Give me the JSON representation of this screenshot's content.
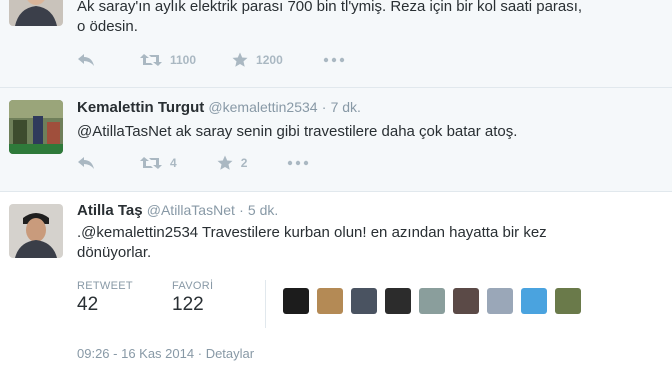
{
  "tweets": [
    {
      "text_line1": "Ak saray'ın aylık elektrik parası 700 bin tl'ymiş. Reza için bir kol saati parası,",
      "text_line2": "o ödesin.",
      "retweets": "1100",
      "favorites": "1200"
    },
    {
      "name": "Kemalettin Turgut",
      "handle": "@kemalettin2534",
      "sep": "·",
      "time": "7 dk.",
      "text": "@AtillaTasNet ak saray senin gibi travestilere daha çok batar atoş.",
      "retweets": "4",
      "favorites": "2"
    },
    {
      "name": "Atilla Taş",
      "handle": "@AtillaTasNet",
      "sep": "·",
      "time": "5 dk.",
      "text_line1": ".@kemalettin2534 Travestilere kurban olun! en azından hayatta bir kez",
      "text_line2": "dönüyorlar.",
      "retweet_label": "RETWEET",
      "retweet_count": "42",
      "favorite_label": "FAVORİ",
      "favorite_count": "122",
      "footer_time": "09:26 - 16 Kas 2014",
      "footer_sep": "·",
      "footer_link": "Detaylar"
    }
  ],
  "colors": {
    "muted": "#8899a6",
    "icon": "#aab8c2",
    "text": "#292f33",
    "tweet_bg": "#f5f8fa"
  },
  "icons": [
    "reply-icon",
    "retweet-icon",
    "star-icon",
    "more-icon"
  ]
}
